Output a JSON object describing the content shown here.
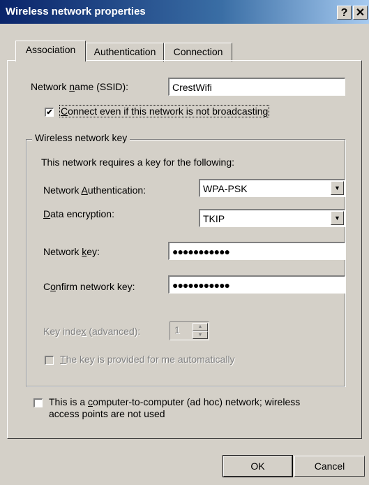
{
  "window": {
    "title": "Wireless network properties",
    "help_button": "?",
    "close_button": "✕"
  },
  "tabs": [
    {
      "label": "Association",
      "active": true
    },
    {
      "label": "Authentication",
      "active": false
    },
    {
      "label": "Connection",
      "active": false
    }
  ],
  "association": {
    "ssid_label_pre": "Network ",
    "ssid_label_u": "n",
    "ssid_label_post": "ame (SSID):",
    "ssid_value": "CrestWifi",
    "connect_broadcast": {
      "label_u": "C",
      "label_rest": "onnect even if this network is not broadcasting",
      "checked": true
    },
    "key_group_title": "Wireless network key",
    "key_requirement_text": "This network requires a key for the following:",
    "auth_label_pre": "Network ",
    "auth_label_u": "A",
    "auth_label_post": "uthentication:",
    "auth_value": "WPA-PSK",
    "enc_label_u": "D",
    "enc_label_post": "ata encryption:",
    "enc_value": "TKIP",
    "netkey_label_pre": "Network ",
    "netkey_label_u": "k",
    "netkey_label_post": "ey:",
    "netkey_value": "●●●●●●●●●●●",
    "confirm_label_pre": "C",
    "confirm_label_u": "o",
    "confirm_label_post": "nfirm network key:",
    "confirm_value": "●●●●●●●●●●●",
    "key_index_label_pre": "Key inde",
    "key_index_label_u": "x",
    "key_index_label_post": " (advanced):",
    "key_index_value": "1",
    "auto_key": {
      "label_u": "T",
      "label_rest": "he key is provided for me automatically",
      "checked": false
    },
    "adhoc": {
      "line1_pre": "This is a ",
      "line1_u": "c",
      "line1_post": "omputer-to-computer (ad hoc) network; wireless",
      "line2": "access points are not used",
      "checked": false
    }
  },
  "buttons": {
    "ok": "OK",
    "cancel": "Cancel"
  }
}
